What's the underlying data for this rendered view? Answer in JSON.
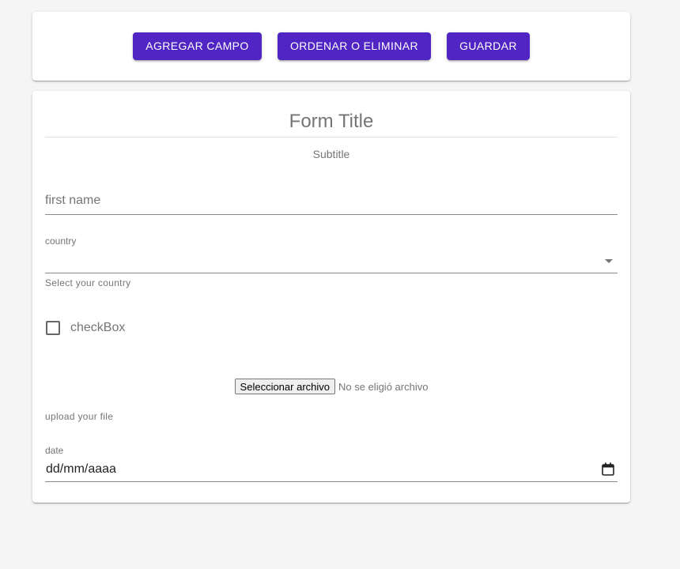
{
  "toolbar": {
    "add_field": "AGREGAR CAMPO",
    "order_delete": "ORDENAR O ELIMINAR",
    "save": "GUARDAR"
  },
  "form": {
    "title": "Form Title",
    "subtitle": "Subtitle",
    "first_name": {
      "placeholder": "first name",
      "value": ""
    },
    "country": {
      "label": "country",
      "value": "",
      "helper": "Select your country"
    },
    "checkbox": {
      "label": "checkBox",
      "checked": false
    },
    "file": {
      "button": "Seleccionar archivo",
      "status": "No se eligió archivo",
      "helper": "upload your file"
    },
    "date": {
      "label": "date",
      "value": "dd/mm/aaaa"
    }
  },
  "colors": {
    "accent": "#5025c4",
    "background": "#f5f5f5"
  },
  "icons": {
    "select": "chevron-down-icon",
    "date": "calendar-icon"
  }
}
